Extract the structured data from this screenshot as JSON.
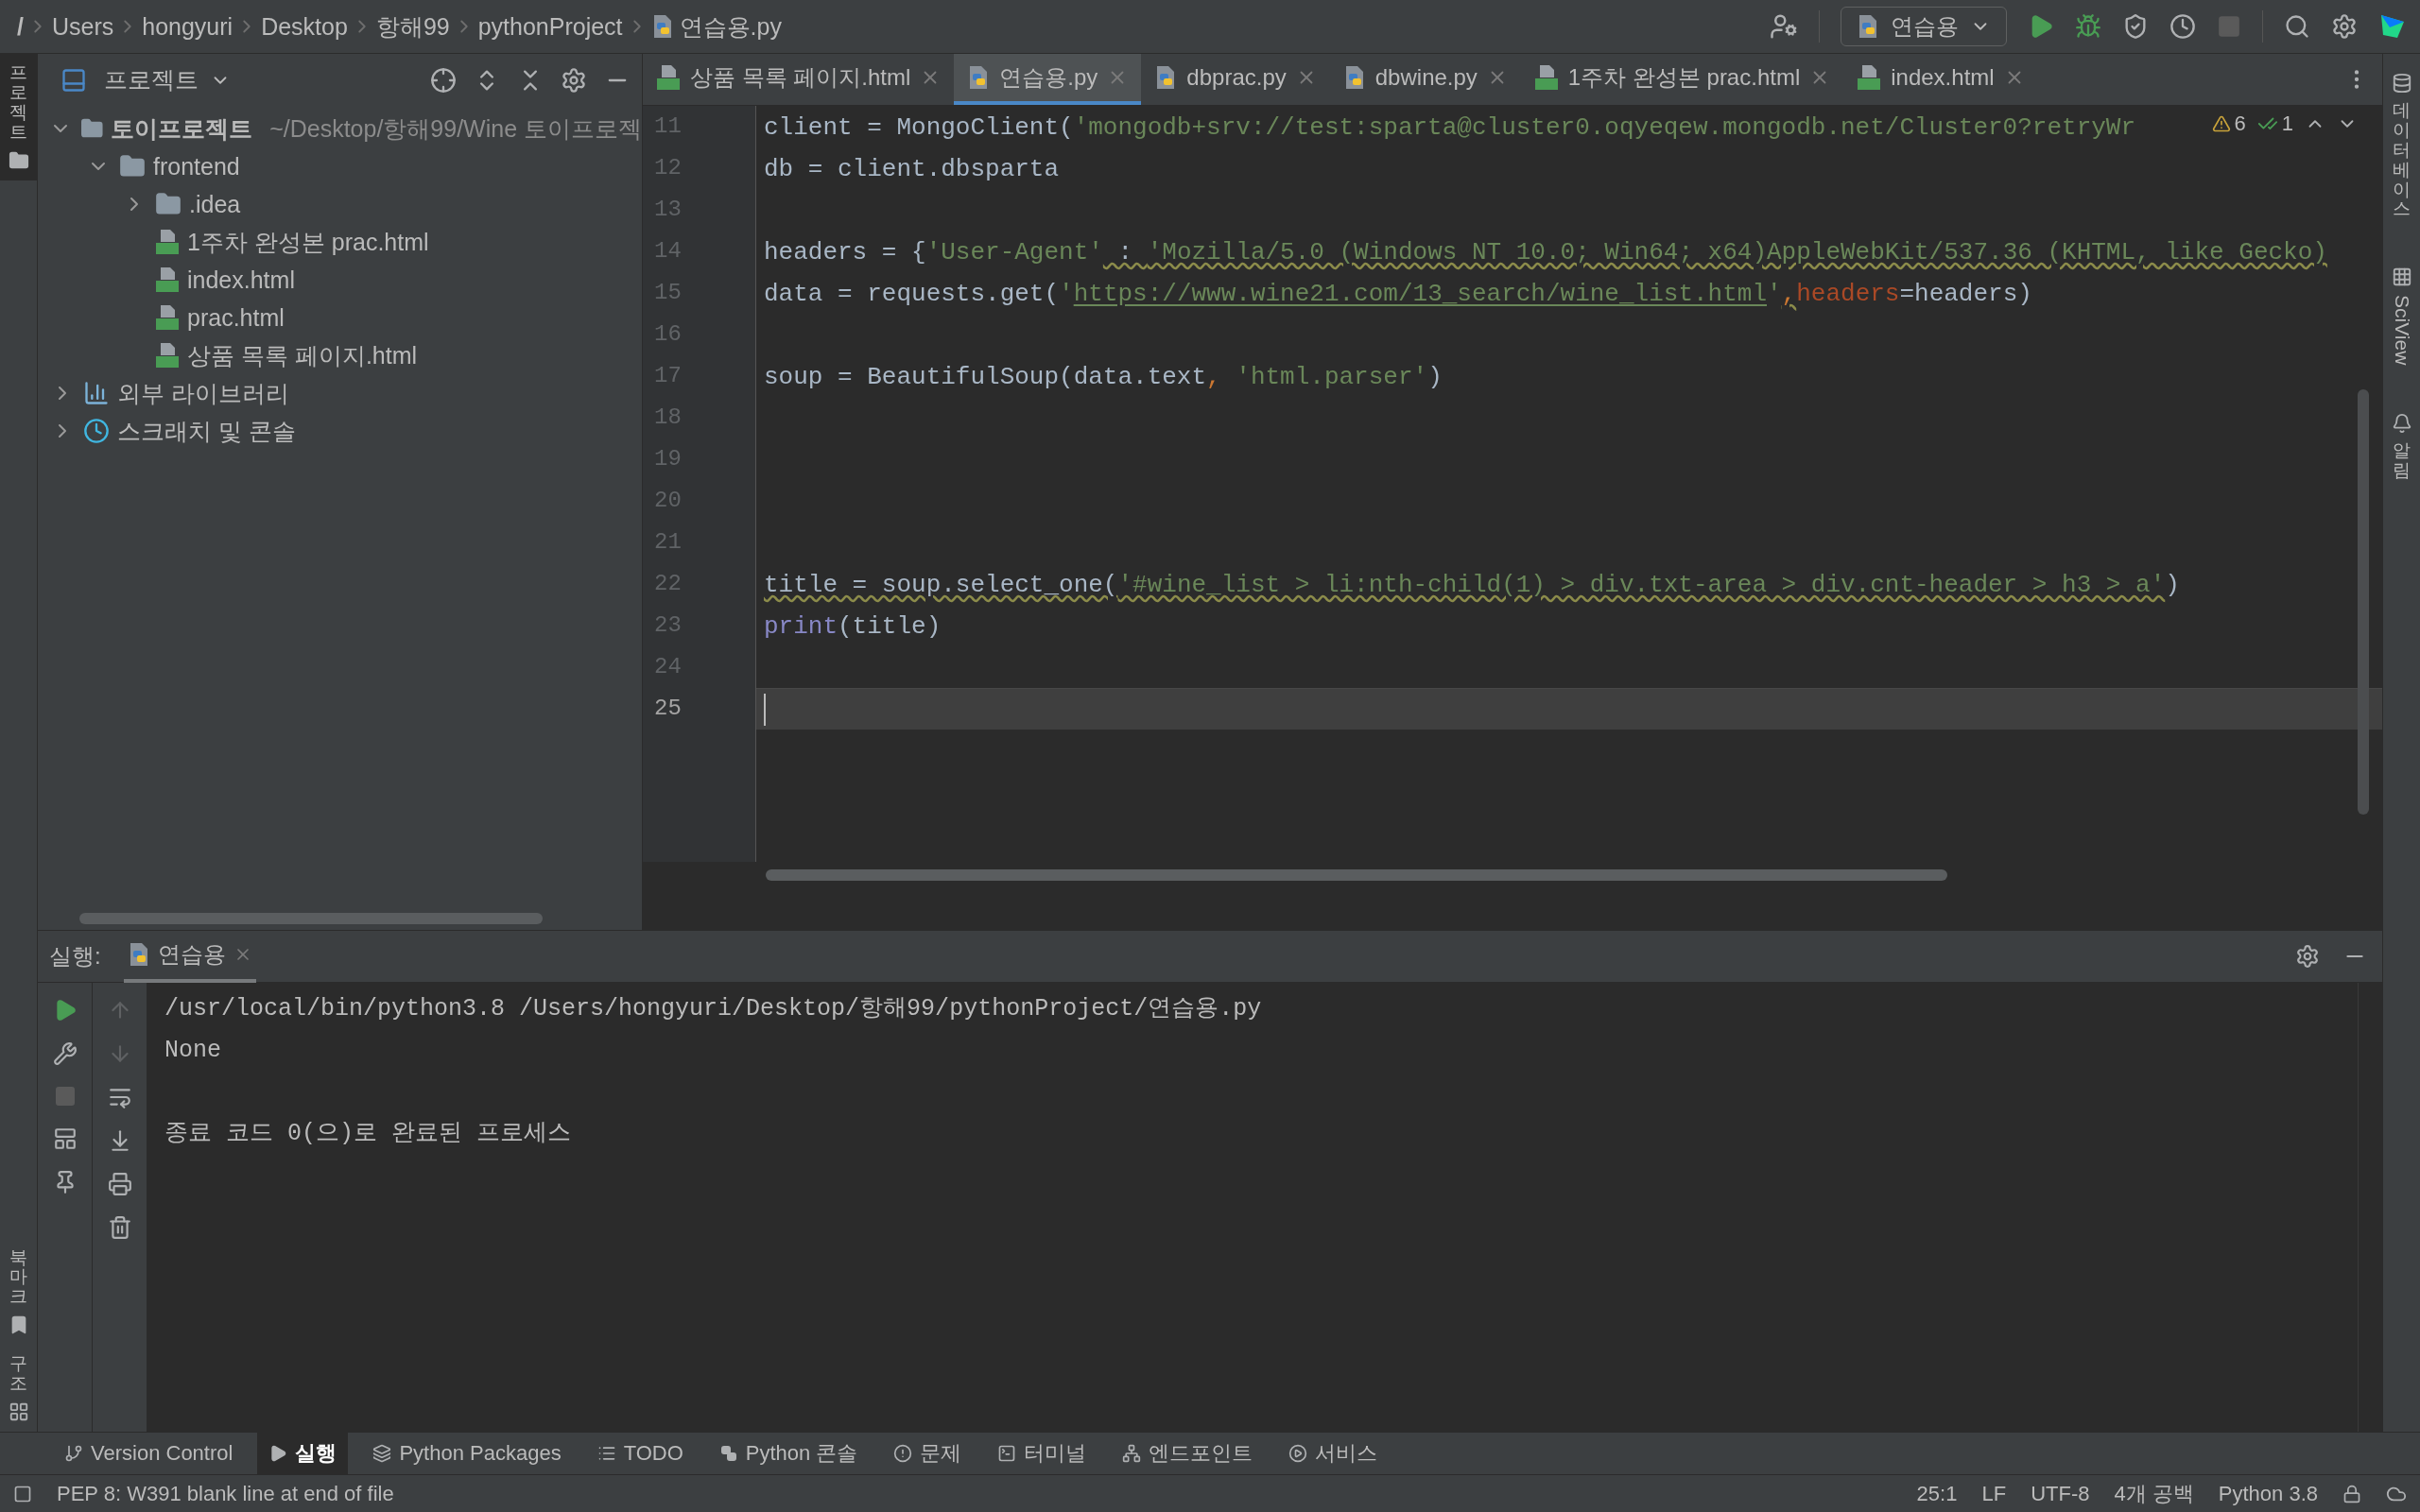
{
  "breadcrumbs": [
    {
      "label": "/",
      "kind": "root"
    },
    {
      "label": "Users",
      "kind": "dir"
    },
    {
      "label": "hongyuri",
      "kind": "dir"
    },
    {
      "label": "Desktop",
      "kind": "dir"
    },
    {
      "label": "항해99",
      "kind": "dir"
    },
    {
      "label": "pythonProject",
      "kind": "dir"
    },
    {
      "label": "연습용.py",
      "kind": "python"
    }
  ],
  "run_config": {
    "label": "연습용"
  },
  "left_strip": [
    {
      "label": "프로젝트",
      "selected": true,
      "kind": "folder"
    },
    {
      "label": "북마크",
      "selected": false,
      "kind": "bookmark"
    },
    {
      "label": "구조",
      "selected": false,
      "kind": "structure"
    }
  ],
  "right_strip": [
    {
      "label": "데이터베이스",
      "kind": "database"
    },
    {
      "label": "SciView",
      "kind": "grid"
    },
    {
      "label": "알림",
      "kind": "bell"
    }
  ],
  "project_panel": {
    "title": "프로젝트"
  },
  "project_tree": [
    {
      "label": "토이프로젝트",
      "path": "~/Desktop/항해99/Wine 토이프로젝",
      "kind": "folder",
      "expanded": true,
      "children": [
        {
          "label": "frontend",
          "kind": "folder",
          "expanded": true,
          "children": [
            {
              "label": ".idea",
              "kind": "folder",
              "expanded": false
            },
            {
              "label": "1주차 완성본 prac.html",
              "kind": "html"
            },
            {
              "label": "index.html",
              "kind": "html"
            },
            {
              "label": "prac.html",
              "kind": "html"
            },
            {
              "label": "상품 목록 페이지.html",
              "kind": "html"
            }
          ]
        }
      ]
    },
    {
      "label": "외부 라이브러리",
      "kind": "library",
      "expanded": false
    },
    {
      "label": "스크래치 및 콘솔",
      "kind": "scratch",
      "expanded": false
    }
  ],
  "tabs": [
    {
      "label": "상품 목록 페이지.html",
      "kind": "html",
      "selected": false
    },
    {
      "label": "연습용.py",
      "kind": "python",
      "selected": true
    },
    {
      "label": "dbprac.py",
      "kind": "python",
      "selected": false
    },
    {
      "label": "dbwine.py",
      "kind": "python",
      "selected": false
    },
    {
      "label": "1주차 완성본 prac.html",
      "kind": "html",
      "selected": false
    },
    {
      "label": "index.html",
      "kind": "html",
      "selected": false
    }
  ],
  "inspections": {
    "warnings": "6",
    "typos": "1"
  },
  "code_lines": [
    {
      "number": "11",
      "current": false,
      "tokens": [
        {
          "text": "client = MongoClient(",
          "kind": "plain"
        },
        {
          "text": "'mongodb+srv://test:sparta@cluster0.oqyeqew.mongodb.net/Cluster0?retryWr",
          "kind": "string"
        }
      ]
    },
    {
      "number": "12",
      "current": false,
      "tokens": [
        {
          "text": "db = client.dbsparta",
          "kind": "plain"
        }
      ]
    },
    {
      "number": "13",
      "current": false
    },
    {
      "number": "14",
      "current": false,
      "tokens": [
        {
          "text": "headers = {",
          "kind": "plain"
        },
        {
          "text": "'User-Agent'",
          "kind": "string"
        },
        {
          "text": " : ",
          "kind": "plain",
          "warning": true
        },
        {
          "text": "'Mozilla/5.0 (Windows NT 10.0; Win64; x64)AppleWebKit/537.36 (KHTML, like Gecko)",
          "kind": "string",
          "warning": true
        }
      ]
    },
    {
      "number": "15",
      "current": false,
      "tokens": [
        {
          "text": "data = requests.get(",
          "kind": "plain"
        },
        {
          "text": "'",
          "kind": "string"
        },
        {
          "text": "https://www.wine21.com/13_search/wine_list.html",
          "kind": "link"
        },
        {
          "text": "'",
          "kind": "string"
        },
        {
          "text": ",",
          "kind": "punct",
          "warning": true
        },
        {
          "text": "headers",
          "kind": "param"
        },
        {
          "text": "=headers)",
          "kind": "plain"
        }
      ]
    },
    {
      "number": "16",
      "current": false
    },
    {
      "number": "17",
      "current": false,
      "tokens": [
        {
          "text": "soup = BeautifulSoup(data.text",
          "kind": "plain"
        },
        {
          "text": ", ",
          "kind": "punct"
        },
        {
          "text": "'html.parser'",
          "kind": "string"
        },
        {
          "text": ")",
          "kind": "plain"
        }
      ]
    },
    {
      "number": "18",
      "current": false
    },
    {
      "number": "19",
      "current": false
    },
    {
      "number": "20",
      "current": false
    },
    {
      "number": "21",
      "current": false
    },
    {
      "number": "22",
      "current": false,
      "tokens": [
        {
          "text": "title = soup.select_one(",
          "kind": "plain",
          "warning": true
        },
        {
          "text": "'#wine_list > li:nth-child(1) > div.txt-area > div.cnt-header > h3 > a'",
          "kind": "string",
          "warning": true
        },
        {
          "text": ")",
          "kind": "plain"
        }
      ]
    },
    {
      "number": "23",
      "current": false,
      "tokens": [
        {
          "text": "print",
          "kind": "builtin"
        },
        {
          "text": "(title)",
          "kind": "plain"
        }
      ]
    },
    {
      "number": "24",
      "current": false
    },
    {
      "number": "25",
      "current": true
    }
  ],
  "run_panel": {
    "title": "실행:",
    "tabs": [
      {
        "label": "연습용",
        "selected": true
      }
    ],
    "console": [
      {
        "text": "/usr/local/bin/python3.8 /Users/hongyuri/Desktop/항해99/pythonProject/연습용.py",
        "kind": "command"
      },
      {
        "text": "None",
        "kind": "output"
      },
      {
        "text": "종료 코드 0(으)로 완료된 프로세스",
        "kind": "exit"
      }
    ]
  },
  "tool_windows": [
    {
      "label": "Version Control",
      "kind": "vcs",
      "selected": false
    },
    {
      "label": "실행",
      "kind": "run",
      "selected": true
    },
    {
      "label": "Python Packages",
      "kind": "packages",
      "selected": false
    },
    {
      "label": "TODO",
      "kind": "todo",
      "selected": false
    },
    {
      "label": "Python 콘솔",
      "kind": "python",
      "selected": false
    },
    {
      "label": "문제",
      "kind": "problems",
      "selected": false
    },
    {
      "label": "터미널",
      "kind": "terminal",
      "selected": false
    },
    {
      "label": "엔드포인트",
      "kind": "endpoints",
      "selected": false
    },
    {
      "label": "서비스",
      "kind": "services",
      "selected": false
    }
  ],
  "status_bar": {
    "message": "PEP 8: W391 blank line at end of file",
    "items": [
      "25:1",
      "LF",
      "UTF-8",
      "4개 공백",
      "Python 3.8"
    ]
  }
}
